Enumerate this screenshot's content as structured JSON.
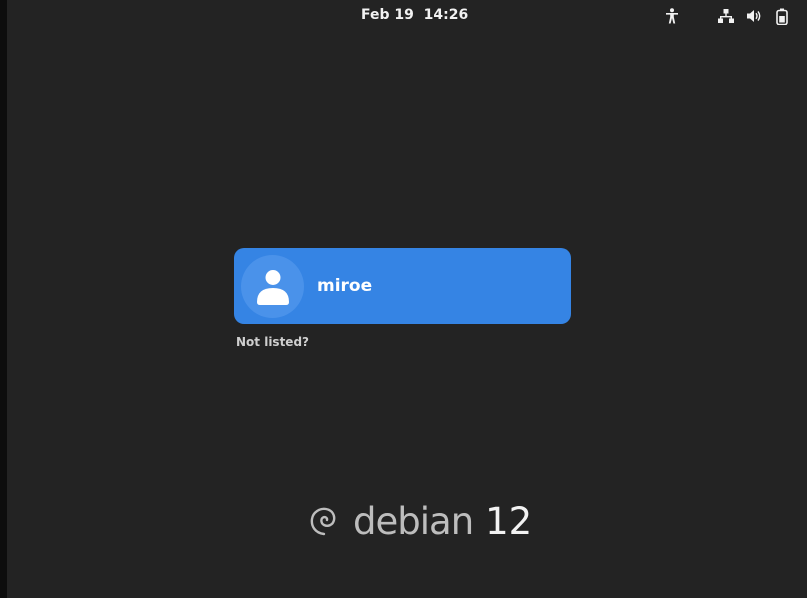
{
  "top_bar": {
    "date": "Feb 19",
    "time": "14:26",
    "icons": [
      "accessibility-icon",
      "network-wired-icon",
      "volume-icon",
      "battery-icon"
    ]
  },
  "login": {
    "users": [
      {
        "name": "miroe",
        "avatar": "default-user-avatar-icon"
      }
    ],
    "not_listed_label": "Not listed?"
  },
  "branding": {
    "distro": "debian",
    "version": "12"
  },
  "colors": {
    "background": "#232323",
    "accent": "#3584e4"
  }
}
